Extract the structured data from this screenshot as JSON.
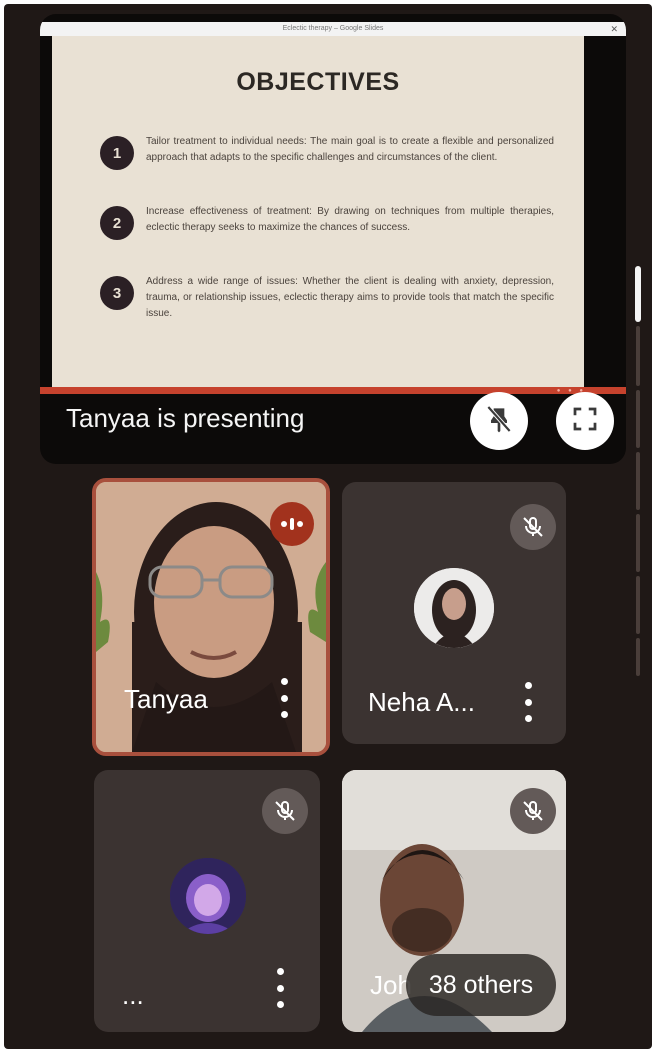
{
  "presentation": {
    "window_title": "Eclectic therapy – Google Slides",
    "slide": {
      "title": "OBJECTIVES",
      "objectives": [
        {
          "number": "1",
          "text": "Tailor treatment to individual needs: The main goal is to create a flexible and personalized approach that adapts to the specific challenges and circumstances of the client."
        },
        {
          "number": "2",
          "text": "Increase effectiveness of treatment: By drawing on techniques from multiple therapies, eclectic therapy seeks to maximize the chances of success."
        },
        {
          "number": "3",
          "text": "Address a wide range of issues: Whether the client is dealing with anxiety, depression, trauma, or relationship issues, eclectic therapy aims to provide tools that match the specific issue."
        }
      ]
    },
    "presenting_label": "Tanyaa is presenting",
    "unpin_icon": "unpin-icon",
    "fullscreen_icon": "fullscreen-icon"
  },
  "participants": [
    {
      "name": "Tanyaa",
      "status": "speaking",
      "icon": "audio-level-icon"
    },
    {
      "name": "Neha A...",
      "status": "muted",
      "icon": "mic-off-icon"
    },
    {
      "name": "...",
      "status": "muted",
      "icon": "mic-off-icon"
    },
    {
      "name": "Joh",
      "status": "muted",
      "icon": "mic-off-icon"
    }
  ],
  "others_label": "38 others",
  "colors": {
    "accent": "#c6422d",
    "background": "#1f1816",
    "tile": "#3b3331",
    "slide": "#e9e1d4"
  }
}
